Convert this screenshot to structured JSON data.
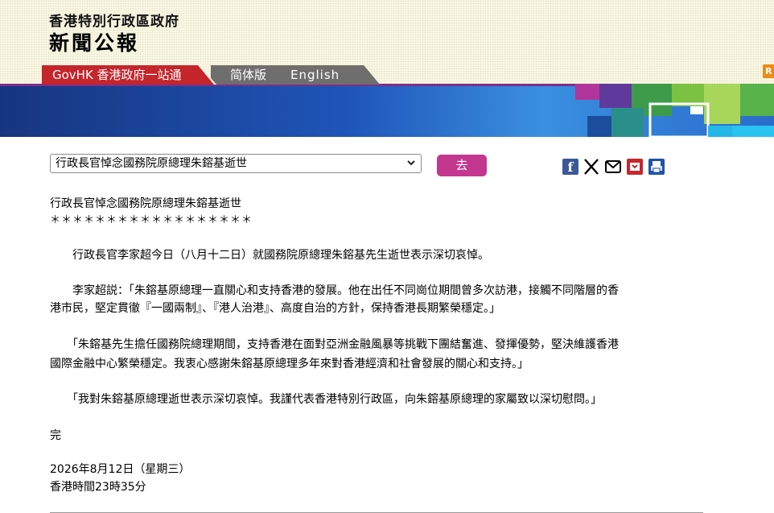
{
  "header": {
    "government": "香港特別行政區政府",
    "site_title": "新聞公報",
    "rss_label": "R"
  },
  "nav": {
    "govhk": "GovHK 香港政府一站通",
    "simplified": "简体版",
    "english": "English"
  },
  "toolbar": {
    "selected_article": "行政長官悼念國務院原總理朱鎔基逝世",
    "go_label": "去",
    "share_icons": [
      "facebook-icon",
      "x-icon",
      "email-icon",
      "weibo-icon",
      "print-icon"
    ]
  },
  "article": {
    "title": "行政長官悼念國務院原總理朱鎔基逝世",
    "separator": "＊＊＊＊＊＊＊＊＊＊＊＊＊＊＊＊＊＊",
    "p1": "　　行政長官李家超今日（八月十二日）就國務院原總理朱鎔基先生逝世表示深切哀悼。",
    "p2_line1": "　　李家超説：「朱鎔基原總理一直關心和支持香港的發展。他在出任不同崗位期間曾多次訪港，接觸不同階層的香",
    "p2_line2": "港市民，堅定貫徹『一國兩制』、『港人治港』、高度自治的方針，保持香港長期繁榮穩定。」",
    "p3_line1": "　　「朱鎔基先生擔任國務院總理期間，支持香港在面對亞洲金融風暴等挑戰下團結奮進、發揮優勢，堅決維護香港",
    "p3_line2": "國際金融中心繁榮穩定。我衷心感謝朱鎔基原總理多年來對香港經濟和社會發展的關心和支持。」",
    "p4": "　　「我對朱鎔基原總理逝世表示深切哀悼。我謹代表香港特別行政區，向朱鎔基原總理的家屬致以深切慰問。」",
    "end": "完",
    "date": "2026年8月12日（星期三）",
    "time": "香港時間23時35分"
  },
  "colors": {
    "header_bg": "#fbf8e2",
    "govhk_tab": "#c4262b",
    "simplified_tab": "#6e6e6e",
    "go_button": "#c3388e",
    "banner_blue": "#1e4fb0"
  }
}
